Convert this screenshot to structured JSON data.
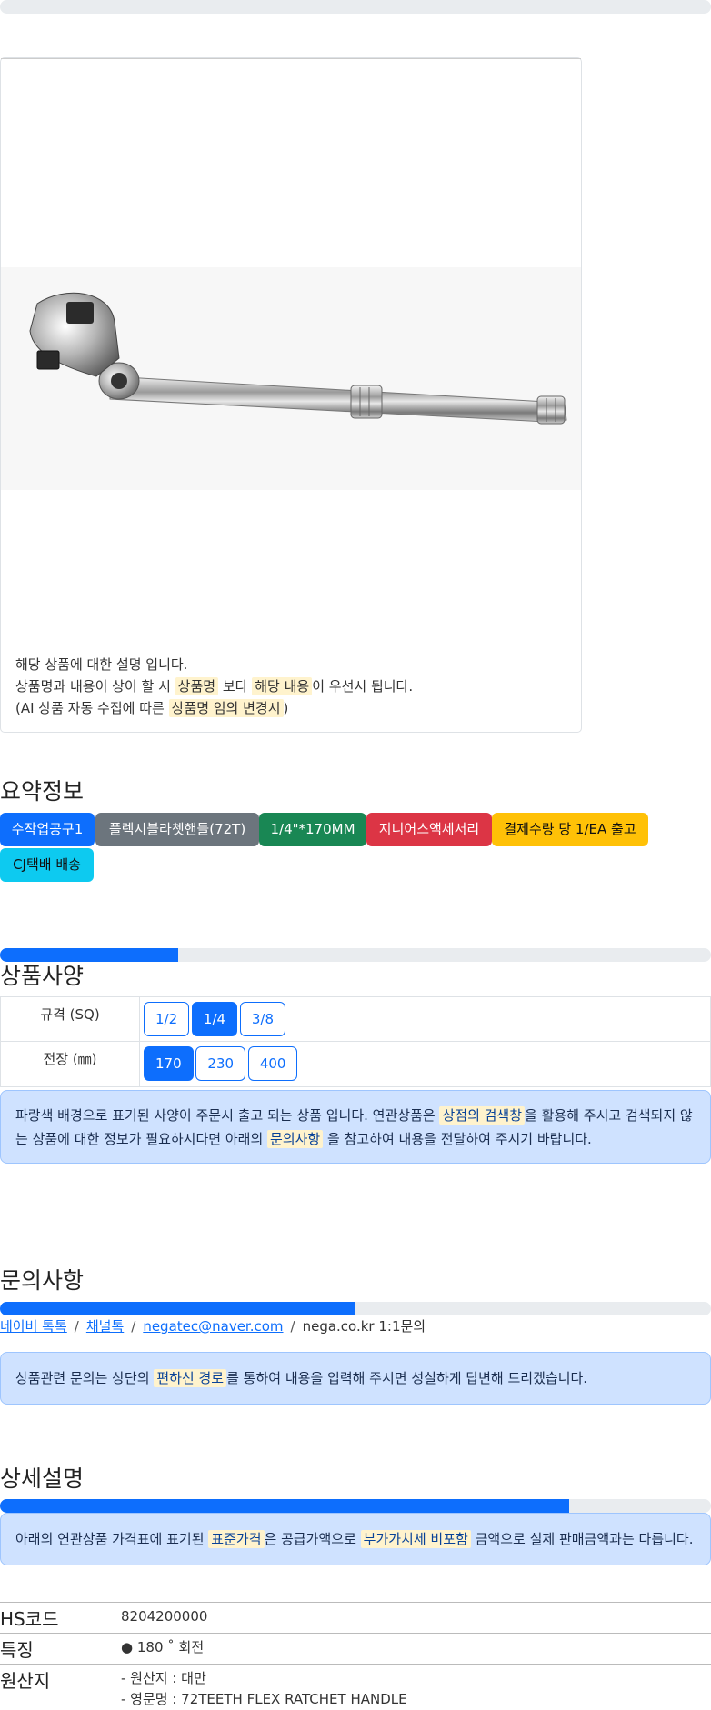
{
  "product": {
    "notice_line1": "해당 상품에 대한 설명 입니다.",
    "notice_line2_a": "상품명과 내용이 상이 할 시",
    "notice_line2_hl1": "상품명",
    "notice_line2_b": "보다",
    "notice_line2_hl2": "해당 내용",
    "notice_line2_c": "이 우선시 됩니다.",
    "notice_line3_a": "(AI 상품 자동 수집에 따른",
    "notice_line3_hl": "상품명 임의 변경시",
    "notice_line3_b": ")"
  },
  "summary": {
    "title": "요약정보",
    "badges": [
      {
        "label": "수작업공구1",
        "color": "#0d6efd"
      },
      {
        "label": "플렉시블라쳇핸들(72T)",
        "color": "#6c757d"
      },
      {
        "label": "1/4\"*170MM",
        "color": "#198754"
      },
      {
        "label": "지니어스액세서리",
        "color": "#dc3545"
      },
      {
        "label": "결제수량 당 1/EA 출고",
        "color": "#ffc107"
      },
      {
        "label": "CJ택배 배송",
        "color": "#0dcaf0"
      }
    ]
  },
  "specs": {
    "title": "상품사양",
    "progress": 0.25,
    "rows": [
      {
        "label": "규격 (SQ)",
        "options": [
          "1/2",
          "1/4",
          "3/8"
        ],
        "selected": 1
      },
      {
        "label": "전장 (㎜)",
        "options": [
          "170",
          "230",
          "400"
        ],
        "selected": 0
      }
    ],
    "alert_a": "파랑색 배경으로 표기된 사양이 주문시 출고 되는 상품 입니다. 연관상품은",
    "alert_hl1": "상점의 검색창",
    "alert_b": "을 활용해 주시고 검색되지 않는 상품에 대한 정보가 필요하시다면 아래의",
    "alert_hl2": "문의사항",
    "alert_c": "을 참고하여 내용을 전달하여 주시기 바랍니다."
  },
  "inquiry": {
    "title": "문의사항",
    "progress": 0.5,
    "links": [
      "네이버 톡톡",
      "채널톡",
      "negatec@naver.com"
    ],
    "plain": "nega.co.kr 1:1문의",
    "alert_a": "상품관련 문의는 상단의",
    "alert_hl": "편하신 경로",
    "alert_b": "를 통하여 내용을 입력해 주시면 성실하게 답변해 드리겠습니다."
  },
  "detail": {
    "title": "상세설명",
    "progress": 0.8,
    "alert_a": "아래의 연관상품 가격표에 표기된",
    "alert_hl1": "표준가격",
    "alert_b": "은 공급가액으로",
    "alert_hl2": "부가가치세 비포함",
    "alert_c": "금액으로 실제 판매금액과는 다릅니다.",
    "rows": [
      {
        "key": "HS코드",
        "lines": [
          "8204200000"
        ]
      },
      {
        "key": "특징",
        "lines": [
          "● 180 ˚ 회전"
        ]
      },
      {
        "key": "원산지",
        "lines": [
          "- 원산지 : 대만",
          "- 영문명 : 72TEETH FLEX RATCHET HANDLE"
        ]
      }
    ]
  }
}
